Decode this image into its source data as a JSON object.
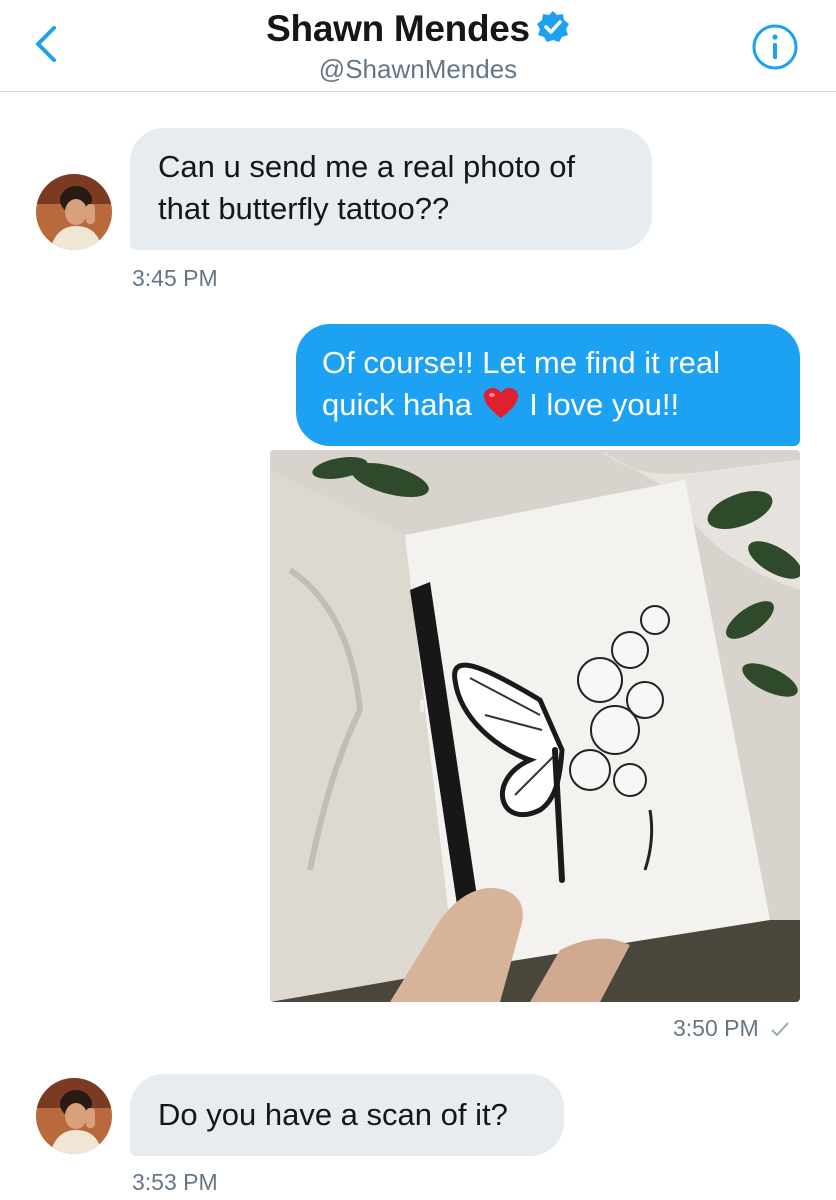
{
  "header": {
    "name": "Shawn Mendes",
    "handle": "@ShawnMendes"
  },
  "messages": {
    "m1": {
      "line1": "Can u send me a real photo of",
      "line2": "that butterfly tattoo??",
      "time": "3:45 PM"
    },
    "m2": {
      "line1": "Of course!! Let me find it real",
      "line2a": "quick haha",
      "line2b": "I love you!!"
    },
    "m3": {
      "time": "3:50 PM"
    },
    "m4": {
      "text": "Do you have a scan of it?",
      "time": "3:53 PM"
    }
  },
  "colors": {
    "accent": "#1da1f2",
    "incoming_bubble": "#e6ecf0",
    "meta_text": "#657786"
  },
  "icons": [
    "chevron-left-icon",
    "verified-badge-icon",
    "info-icon",
    "red-heart-emoji",
    "checkmark-icon"
  ]
}
